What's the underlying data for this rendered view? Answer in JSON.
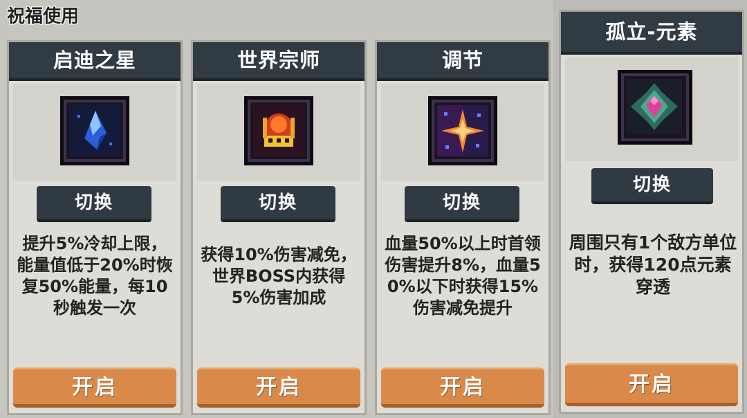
{
  "panel": {
    "title": "祝福使用"
  },
  "cards": [
    {
      "name": "启迪之星",
      "switch_label": "切换",
      "desc": "提升5%冷却上限，能量值低于20%时恢复50%能量，每10秒触发一次",
      "open_label": "开启",
      "icon": "blue-crystal-icon"
    },
    {
      "name": "世界宗师",
      "switch_label": "切换",
      "desc": "获得10%伤害减免，世界BOSS内获得5%伤害加成",
      "open_label": "开启",
      "icon": "crown-icon"
    },
    {
      "name": "调节",
      "switch_label": "切换",
      "desc": "血量50%以上时首领伤害提升8%，血量50%以下时获得15%伤害减免提升",
      "open_label": "开启",
      "icon": "star-burst-icon"
    },
    {
      "name": "孤立-元素",
      "switch_label": "切换",
      "desc": "周围只有1个敌方单位时，获得120点元素穿透",
      "open_label": "开启",
      "icon": "pink-gem-icon"
    }
  ],
  "colors": {
    "header": "#303b44",
    "open_button": "#d9894a",
    "card_bg": "#dddcd6"
  }
}
